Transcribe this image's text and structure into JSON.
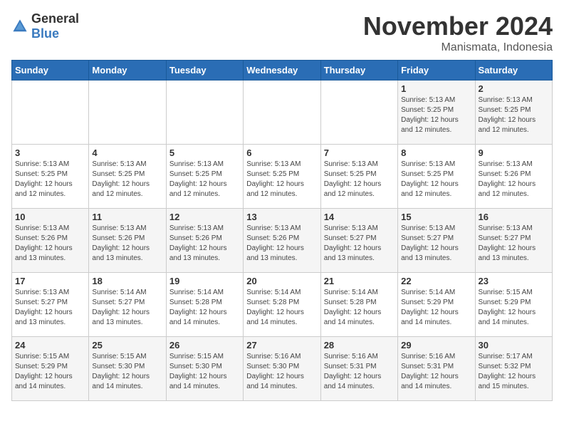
{
  "header": {
    "logo_general": "General",
    "logo_blue": "Blue",
    "month_title": "November 2024",
    "subtitle": "Manismata, Indonesia"
  },
  "days_of_week": [
    "Sunday",
    "Monday",
    "Tuesday",
    "Wednesday",
    "Thursday",
    "Friday",
    "Saturday"
  ],
  "weeks": [
    [
      {
        "day": "",
        "info": ""
      },
      {
        "day": "",
        "info": ""
      },
      {
        "day": "",
        "info": ""
      },
      {
        "day": "",
        "info": ""
      },
      {
        "day": "",
        "info": ""
      },
      {
        "day": "1",
        "info": "Sunrise: 5:13 AM\nSunset: 5:25 PM\nDaylight: 12 hours\nand 12 minutes."
      },
      {
        "day": "2",
        "info": "Sunrise: 5:13 AM\nSunset: 5:25 PM\nDaylight: 12 hours\nand 12 minutes."
      }
    ],
    [
      {
        "day": "3",
        "info": "Sunrise: 5:13 AM\nSunset: 5:25 PM\nDaylight: 12 hours\nand 12 minutes."
      },
      {
        "day": "4",
        "info": "Sunrise: 5:13 AM\nSunset: 5:25 PM\nDaylight: 12 hours\nand 12 minutes."
      },
      {
        "day": "5",
        "info": "Sunrise: 5:13 AM\nSunset: 5:25 PM\nDaylight: 12 hours\nand 12 minutes."
      },
      {
        "day": "6",
        "info": "Sunrise: 5:13 AM\nSunset: 5:25 PM\nDaylight: 12 hours\nand 12 minutes."
      },
      {
        "day": "7",
        "info": "Sunrise: 5:13 AM\nSunset: 5:25 PM\nDaylight: 12 hours\nand 12 minutes."
      },
      {
        "day": "8",
        "info": "Sunrise: 5:13 AM\nSunset: 5:25 PM\nDaylight: 12 hours\nand 12 minutes."
      },
      {
        "day": "9",
        "info": "Sunrise: 5:13 AM\nSunset: 5:26 PM\nDaylight: 12 hours\nand 12 minutes."
      }
    ],
    [
      {
        "day": "10",
        "info": "Sunrise: 5:13 AM\nSunset: 5:26 PM\nDaylight: 12 hours\nand 13 minutes."
      },
      {
        "day": "11",
        "info": "Sunrise: 5:13 AM\nSunset: 5:26 PM\nDaylight: 12 hours\nand 13 minutes."
      },
      {
        "day": "12",
        "info": "Sunrise: 5:13 AM\nSunset: 5:26 PM\nDaylight: 12 hours\nand 13 minutes."
      },
      {
        "day": "13",
        "info": "Sunrise: 5:13 AM\nSunset: 5:26 PM\nDaylight: 12 hours\nand 13 minutes."
      },
      {
        "day": "14",
        "info": "Sunrise: 5:13 AM\nSunset: 5:27 PM\nDaylight: 12 hours\nand 13 minutes."
      },
      {
        "day": "15",
        "info": "Sunrise: 5:13 AM\nSunset: 5:27 PM\nDaylight: 12 hours\nand 13 minutes."
      },
      {
        "day": "16",
        "info": "Sunrise: 5:13 AM\nSunset: 5:27 PM\nDaylight: 12 hours\nand 13 minutes."
      }
    ],
    [
      {
        "day": "17",
        "info": "Sunrise: 5:13 AM\nSunset: 5:27 PM\nDaylight: 12 hours\nand 13 minutes."
      },
      {
        "day": "18",
        "info": "Sunrise: 5:14 AM\nSunset: 5:27 PM\nDaylight: 12 hours\nand 13 minutes."
      },
      {
        "day": "19",
        "info": "Sunrise: 5:14 AM\nSunset: 5:28 PM\nDaylight: 12 hours\nand 14 minutes."
      },
      {
        "day": "20",
        "info": "Sunrise: 5:14 AM\nSunset: 5:28 PM\nDaylight: 12 hours\nand 14 minutes."
      },
      {
        "day": "21",
        "info": "Sunrise: 5:14 AM\nSunset: 5:28 PM\nDaylight: 12 hours\nand 14 minutes."
      },
      {
        "day": "22",
        "info": "Sunrise: 5:14 AM\nSunset: 5:29 PM\nDaylight: 12 hours\nand 14 minutes."
      },
      {
        "day": "23",
        "info": "Sunrise: 5:15 AM\nSunset: 5:29 PM\nDaylight: 12 hours\nand 14 minutes."
      }
    ],
    [
      {
        "day": "24",
        "info": "Sunrise: 5:15 AM\nSunset: 5:29 PM\nDaylight: 12 hours\nand 14 minutes."
      },
      {
        "day": "25",
        "info": "Sunrise: 5:15 AM\nSunset: 5:30 PM\nDaylight: 12 hours\nand 14 minutes."
      },
      {
        "day": "26",
        "info": "Sunrise: 5:15 AM\nSunset: 5:30 PM\nDaylight: 12 hours\nand 14 minutes."
      },
      {
        "day": "27",
        "info": "Sunrise: 5:16 AM\nSunset: 5:30 PM\nDaylight: 12 hours\nand 14 minutes."
      },
      {
        "day": "28",
        "info": "Sunrise: 5:16 AM\nSunset: 5:31 PM\nDaylight: 12 hours\nand 14 minutes."
      },
      {
        "day": "29",
        "info": "Sunrise: 5:16 AM\nSunset: 5:31 PM\nDaylight: 12 hours\nand 14 minutes."
      },
      {
        "day": "30",
        "info": "Sunrise: 5:17 AM\nSunset: 5:32 PM\nDaylight: 12 hours\nand 15 minutes."
      }
    ]
  ]
}
